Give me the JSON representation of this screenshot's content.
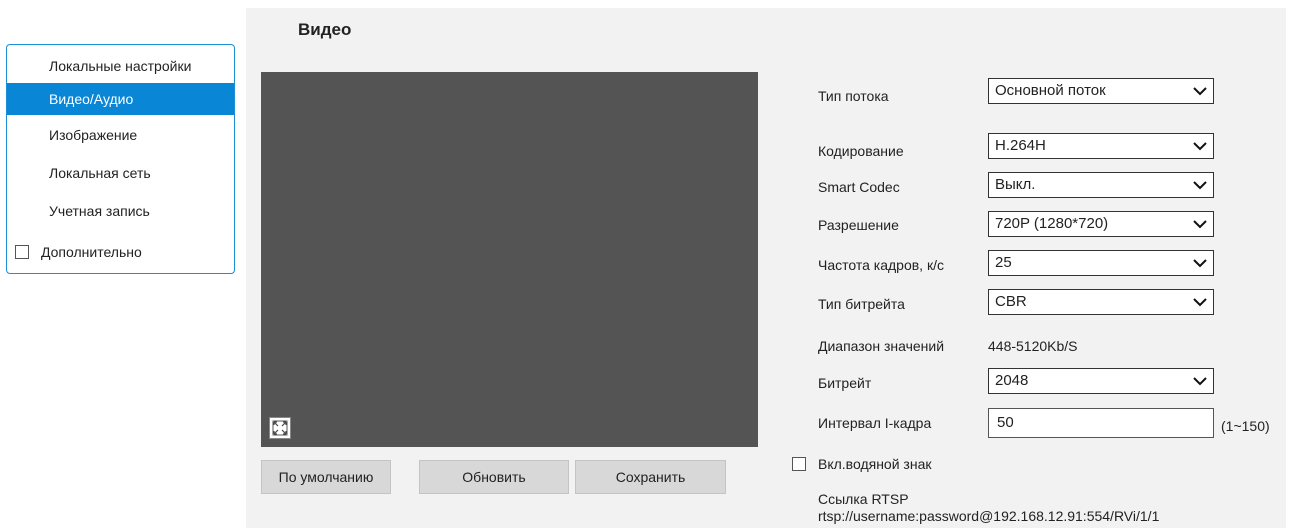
{
  "sidebar": {
    "items": [
      {
        "label": "Локальные настройки"
      },
      {
        "label": "Видео/Аудио"
      },
      {
        "label": "Изображение"
      },
      {
        "label": "Локальная сеть"
      },
      {
        "label": "Учетная запись"
      }
    ],
    "active_index": 1,
    "advanced_label": "Дополнительно",
    "advanced_checked": false
  },
  "main": {
    "title": "Видео",
    "buttons": {
      "default_label": "По умолчанию",
      "refresh_label": "Обновить",
      "save_label": "Сохранить"
    },
    "settings": {
      "stream_type": {
        "label": "Тип потока",
        "value": "Основной поток"
      },
      "encoding": {
        "label": "Кодирование",
        "value": "H.264H"
      },
      "smart_codec": {
        "label": "Smart Codec",
        "value": "Выкл."
      },
      "resolution": {
        "label": "Разрешение",
        "value": "720P (1280*720)"
      },
      "frame_rate": {
        "label": "Частота кадров, к/с",
        "value": "25"
      },
      "bitrate_type": {
        "label": "Тип битрейта",
        "value": "CBR"
      },
      "value_range": {
        "label": "Диапазон значений",
        "value": "448-5120Kb/S"
      },
      "bitrate": {
        "label": "Битрейт",
        "value": "2048"
      },
      "i_frame_interval": {
        "label": "Интервал I-кадра",
        "value": "50",
        "hint": "(1~150)"
      }
    },
    "watermark": {
      "label": "Вкл.водяной знак",
      "checked": false
    },
    "rtsp": {
      "label": "Ссылка RTSP",
      "url": "rtsp://username:password@192.168.12.91:554/RVi/1/1"
    }
  },
  "colors": {
    "accent": "#0a86d6",
    "panel_bg": "#f2f2f2",
    "video_bg": "#545454",
    "button_bg": "#d8d8d8"
  },
  "icons": {
    "fullscreen": "fullscreen-icon",
    "dropdown": "chevron-down-icon"
  }
}
